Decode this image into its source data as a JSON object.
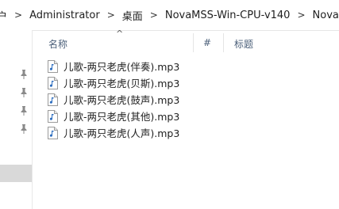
{
  "breadcrumb": {
    "items": [
      "户",
      "Administrator",
      "桌面",
      "NovaMSS-Win-CPU-v140",
      "NovaMSS"
    ],
    "separator": ">"
  },
  "columns": {
    "name": "名称",
    "number": "#",
    "title": "标题",
    "sort_indicator": "^"
  },
  "files": [
    {
      "name": "儿歌-两只老虎(伴奏).mp3",
      "icon": "audio-file-icon"
    },
    {
      "name": "儿歌-两只老虎(贝斯).mp3",
      "icon": "audio-file-icon"
    },
    {
      "name": "儿歌-两只老虎(鼓声).mp3",
      "icon": "audio-file-icon"
    },
    {
      "name": "儿歌-两只老虎(其他).mp3",
      "icon": "audio-file-icon"
    },
    {
      "name": "儿歌-两只老虎(人声).mp3",
      "icon": "audio-file-icon"
    }
  ],
  "nav_pins": [
    "pin-icon",
    "pin-icon",
    "pin-icon",
    "pin-icon"
  ],
  "colors": {
    "header_text": "#4c607a",
    "selected_nav": "#d9d9d9",
    "icon_note": "#2f6fc0"
  }
}
